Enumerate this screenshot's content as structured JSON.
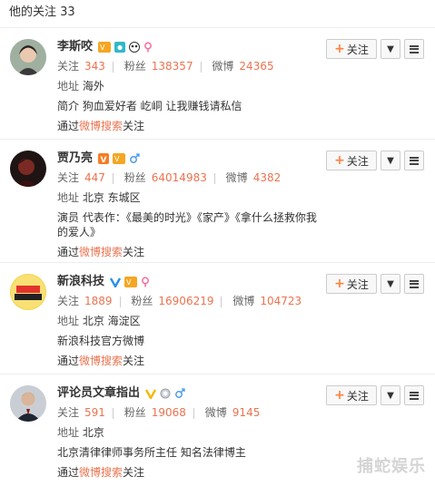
{
  "header": {
    "title": "他的关注 33"
  },
  "labels": {
    "follow_btn": "关注",
    "following": "关注",
    "fans": "粉丝",
    "weibo": "微博",
    "address": "地址",
    "via_prefix": "通过",
    "via_suffix": "关注"
  },
  "users": [
    {
      "name": "李斯咬",
      "badges": [
        "vip-icon",
        "camera-icon",
        "panda-icon",
        "female-icon"
      ],
      "following": "343",
      "fans": "138357",
      "weibo": "24365",
      "address": "海外",
      "bio": "简介 狗血爱好者 屹峒 让我赚钱请私信",
      "via": "微博搜索"
    },
    {
      "name": "贾乃亮",
      "badges": [
        "verified-orange-icon",
        "vip-icon",
        "male-icon"
      ],
      "following": "447",
      "fans": "64014983",
      "weibo": "4382",
      "address": "北京 东城区",
      "bio": "演员 代表作：《最美的时光》《家产》《拿什么拯救你我的爱人》",
      "via": "微博搜索"
    },
    {
      "name": "新浪科技",
      "badges": [
        "verified-blue-icon",
        "vip-icon",
        "female-icon"
      ],
      "following": "1889",
      "fans": "16906219",
      "weibo": "104723",
      "address": "北京 海淀区",
      "bio": "新浪科技官方微博",
      "via": "微博搜索"
    },
    {
      "name": "评论员文章指出",
      "badges": [
        "verified-yellow-icon",
        "medal-icon",
        "male-icon"
      ],
      "following": "591",
      "fans": "19068",
      "weibo": "9145",
      "address": "北京",
      "bio": "北京清律律师事务所主任 知名法律博主",
      "via": "微博搜索"
    }
  ],
  "watermark": "捕蛇娱乐",
  "colors": {
    "accent": "#eb7350",
    "orange_plus": "#ff8140"
  }
}
